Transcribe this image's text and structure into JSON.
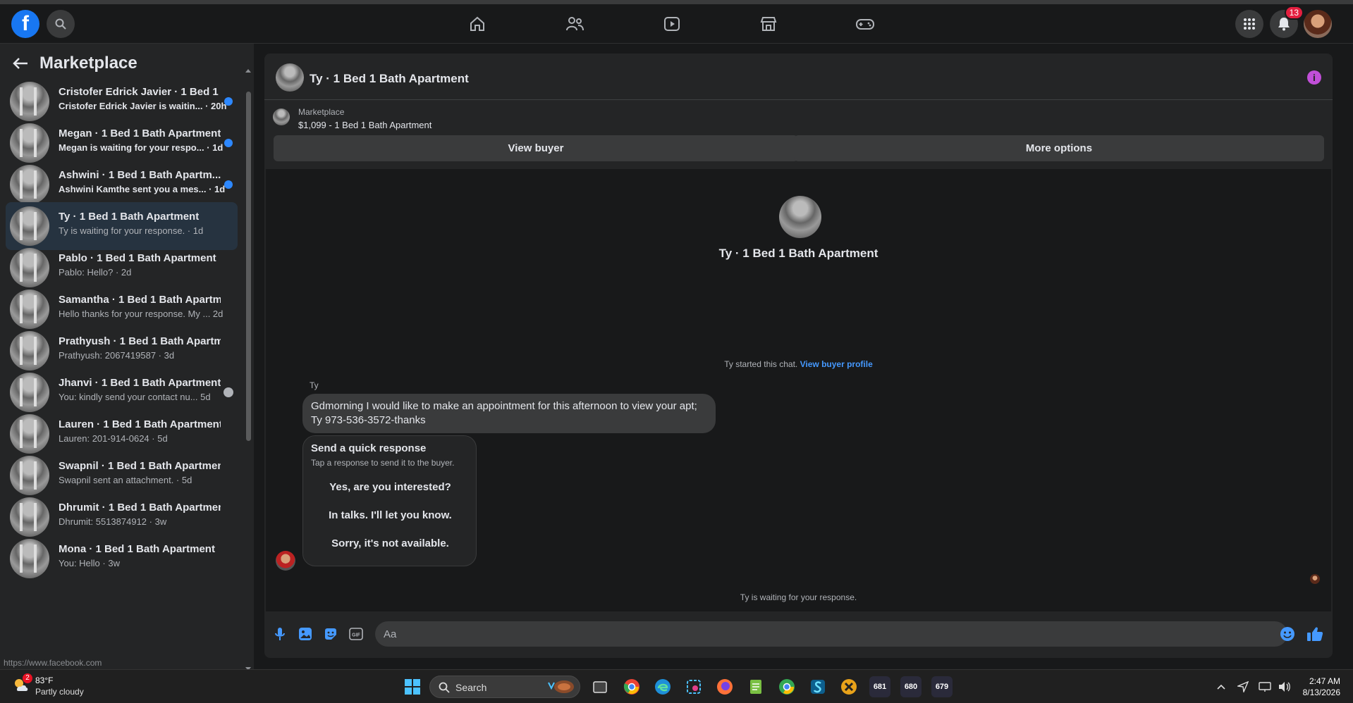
{
  "browser": {
    "status_url": "https://www.facebook.com"
  },
  "topnav": {
    "logo_letter": "f",
    "notifications_count": "13",
    "nav_icons": [
      "home-icon",
      "friends-icon",
      "video-icon",
      "marketplace-icon",
      "gaming-icon"
    ]
  },
  "sidebar": {
    "title": "Marketplace",
    "conversations": [
      {
        "name": "Cristofer Edrick Javier · 1 Bed 1 ...",
        "preview": "Cristofer Edrick Javier is waitin... · 20h",
        "unread": true
      },
      {
        "name": "Megan · 1 Bed 1 Bath Apartment",
        "preview": "Megan is waiting for your respo... · 1d",
        "unread": true
      },
      {
        "name": "Ashwini · 1 Bed 1 Bath Apartm...",
        "preview": "Ashwini Kamthe sent you a mes... · 1d",
        "unread": true
      },
      {
        "name": "Ty · 1 Bed 1 Bath Apartment",
        "preview": "Ty is waiting for your response. · 1d",
        "unread": false,
        "active": true
      },
      {
        "name": "Pablo · 1 Bed 1 Bath Apartment",
        "preview": "Pablo: Hello? · 2d",
        "unread": false
      },
      {
        "name": "Samantha · 1 Bed 1 Bath Apartm...",
        "preview": "Hello thanks for your response. My ... 2d",
        "unread": false
      },
      {
        "name": "Prathyush · 1 Bed 1 Bath Apartm...",
        "preview": "Prathyush: 2067419587 · 3d",
        "unread": false
      },
      {
        "name": "Jhanvi · 1 Bed 1 Bath Apartment",
        "preview": "You: kindly send your contact nu...  5d",
        "unread": false,
        "seen": true
      },
      {
        "name": "Lauren · 1 Bed 1 Bath Apartment",
        "preview": "Lauren: 201-914-0624 · 5d",
        "unread": false
      },
      {
        "name": "Swapnil · 1 Bed 1 Bath Apartment",
        "preview": "Swapnil sent an attachment. · 5d",
        "unread": false
      },
      {
        "name": "Dhrumit · 1 Bed 1 Bath Apartment",
        "preview": "Dhrumit: 5513874912 · 3w",
        "unread": false
      },
      {
        "name": "Mona · 1 Bed 1 Bath Apartment",
        "preview": "You: Hello · 3w",
        "unread": false
      }
    ]
  },
  "chat": {
    "title": "Ty · 1 Bed 1 Bath Apartment",
    "marketplace_label": "Marketplace",
    "listing": "$1,099 - 1 Bed 1 Bath Apartment",
    "view_buyer": "View buyer",
    "more_options": "More options",
    "hero_title": "Ty · 1 Bed 1 Bath Apartment",
    "started_text": "Ty started this chat.",
    "view_buyer_profile": "View buyer profile",
    "sender_name": "Ty",
    "message_line1": "Gdmorning I would like to make an appointment for this afternoon to view your apt;",
    "message_line2": "Ty 973-536-3572-thanks",
    "quick_title": "Send a quick response",
    "quick_subtitle": "Tap a response to send it to the buyer.",
    "quick_responses": [
      "Yes, are you interested?",
      "In talks. I'll let you know.",
      "Sorry, it's not available."
    ],
    "waiting": "Ty is waiting for your response.",
    "input_placeholder": "Aa"
  },
  "taskbar": {
    "weather_temp": "83°F",
    "weather_cond": "Partly cloudy",
    "weather_badge": "2",
    "search_label": "Search",
    "badges": [
      "681",
      "680",
      "679"
    ],
    "time": "2:47 AM",
    "date": "8/13/2026"
  }
}
